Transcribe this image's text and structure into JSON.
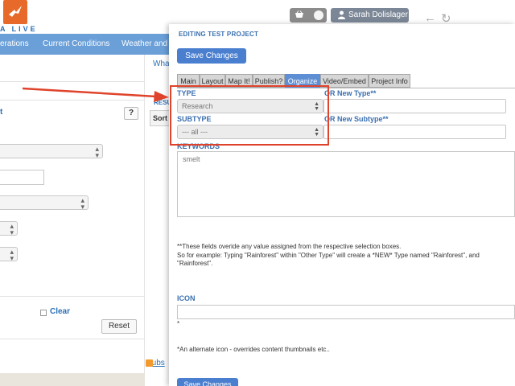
{
  "app": {
    "logo_text": "A LIVE",
    "user_name": "Sarah Dolislager",
    "accent_color": "#6a9fd8",
    "highlight_color": "#e0432b"
  },
  "nav": {
    "items": [
      "erations",
      "Current Conditions",
      "Weather and T"
    ]
  },
  "left_panel": {
    "section_label": "t",
    "help_label": "?",
    "clear_label": "Clear",
    "reset_label": "Reset"
  },
  "mid_panel": {
    "tab_label": "What",
    "results_label": "RESU",
    "sort_label": "Sort",
    "subscribe_label": "Subs"
  },
  "modal": {
    "title": "EDITING TEST PROJECT",
    "save_label": "Save Changes",
    "tabs": [
      {
        "label": "Main",
        "active": false
      },
      {
        "label": "Layout",
        "active": false
      },
      {
        "label": "Map It!",
        "active": false
      },
      {
        "label": "Publish?",
        "active": false
      },
      {
        "label": "Organize",
        "active": true
      },
      {
        "label": "Video/Embed",
        "active": false
      },
      {
        "label": "Project Info",
        "active": false
      }
    ],
    "type_label": "TYPE",
    "type_value": "Research",
    "new_type_label": "OR New Type**",
    "subtype_label": "SUBTYPE",
    "subtype_value": "--- all ---",
    "new_subtype_label": "OR New Subtype**",
    "keywords_label": "KEYWORDS",
    "keywords_value": "smelt",
    "note_lines": [
      "**These fields overide any value assigned from the respective selection boxes.",
      "So for example: Typing \"Rainforest\" within \"Other Type\" will create a *NEW* Type named \"Rainforest\", and",
      "\"Rainforest\"."
    ],
    "icon_label": "ICON",
    "icon_asterisk": "*",
    "icon_note": "*An alternate icon - overrides content thumbnails etc..",
    "save_bottom_label": "Save Changes"
  }
}
